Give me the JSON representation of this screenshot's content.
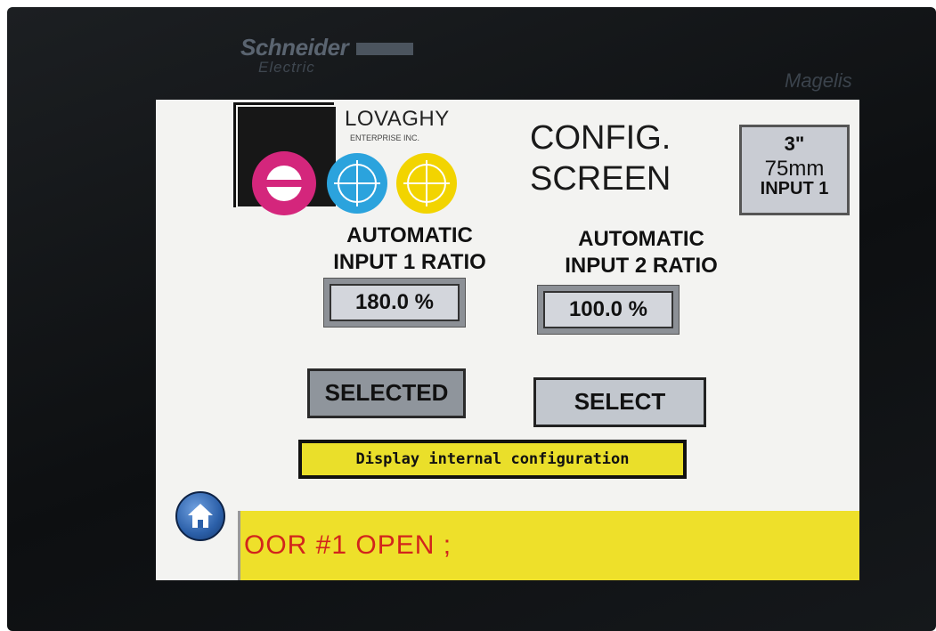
{
  "device": {
    "brand": "Schneider",
    "brand_sub": "Electric",
    "model": "Magelis"
  },
  "logo": {
    "name": "LOVAGHY",
    "sub": "ENTERPRISE INC."
  },
  "header": {
    "title_line1": "CONFIG.",
    "title_line2": "SCREEN"
  },
  "size_indicator": {
    "inch": "3\"",
    "mm": "75mm",
    "input": "INPUT 1"
  },
  "input1": {
    "label_line1": "AUTOMATIC",
    "label_line2": "INPUT 1 RATIO",
    "value": "180.0 %",
    "button": "SELECTED"
  },
  "input2": {
    "label_line1": "AUTOMATIC",
    "label_line2": "INPUT 2 RATIO",
    "value": "100.0 %",
    "button": "SELECT"
  },
  "actions": {
    "display_config": "Display internal configuration"
  },
  "alarm": {
    "message": "OOR #1 OPEN ;"
  },
  "colors": {
    "alarm_bg": "#eee02a",
    "alarm_text": "#d2251c",
    "info_button_bg": "#eadf2a",
    "selected_button": "#8f959c",
    "unselected_button": "#c2c7ce"
  }
}
